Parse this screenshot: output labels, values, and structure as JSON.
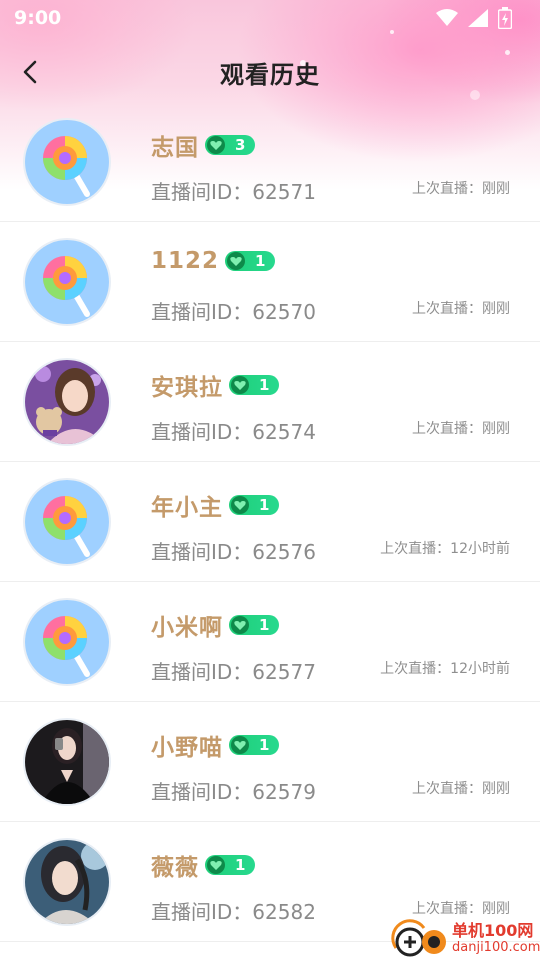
{
  "status_bar": {
    "time": "9:00"
  },
  "header": {
    "title": "观看历史"
  },
  "colors": {
    "name": "#c49a6a",
    "level_badge": "#1fcf7a",
    "id_text": "#8a8a8a"
  },
  "rows": [
    {
      "name": "志国",
      "level": "3",
      "room_id": "直播间ID：62571",
      "last_live": "上次直播：刚刚",
      "avatar": "lollipop"
    },
    {
      "name": "1122",
      "level": "1",
      "room_id": "直播间ID：62570",
      "last_live": "上次直播：刚刚",
      "avatar": "lollipop"
    },
    {
      "name": "安琪拉",
      "level": "1",
      "room_id": "直播间ID：62574",
      "last_live": "上次直播：刚刚",
      "avatar": "photo-purple"
    },
    {
      "name": "年小主",
      "level": "1",
      "room_id": "直播间ID：62576",
      "last_live": "上次直播：12小时前",
      "avatar": "lollipop"
    },
    {
      "name": "小米啊",
      "level": "1",
      "room_id": "直播间ID：62577",
      "last_live": "上次直播：12小时前",
      "avatar": "lollipop"
    },
    {
      "name": "小野喵",
      "level": "1",
      "room_id": "直播间ID：62579",
      "last_live": "上次直播：刚刚",
      "avatar": "photo-dark"
    },
    {
      "name": "薇薇",
      "level": "1",
      "room_id": "直播间ID：62582",
      "last_live": "上次直播：刚刚",
      "avatar": "photo-blue"
    }
  ],
  "watermark": {
    "main": "单机100网",
    "sub": "danji100.com"
  }
}
